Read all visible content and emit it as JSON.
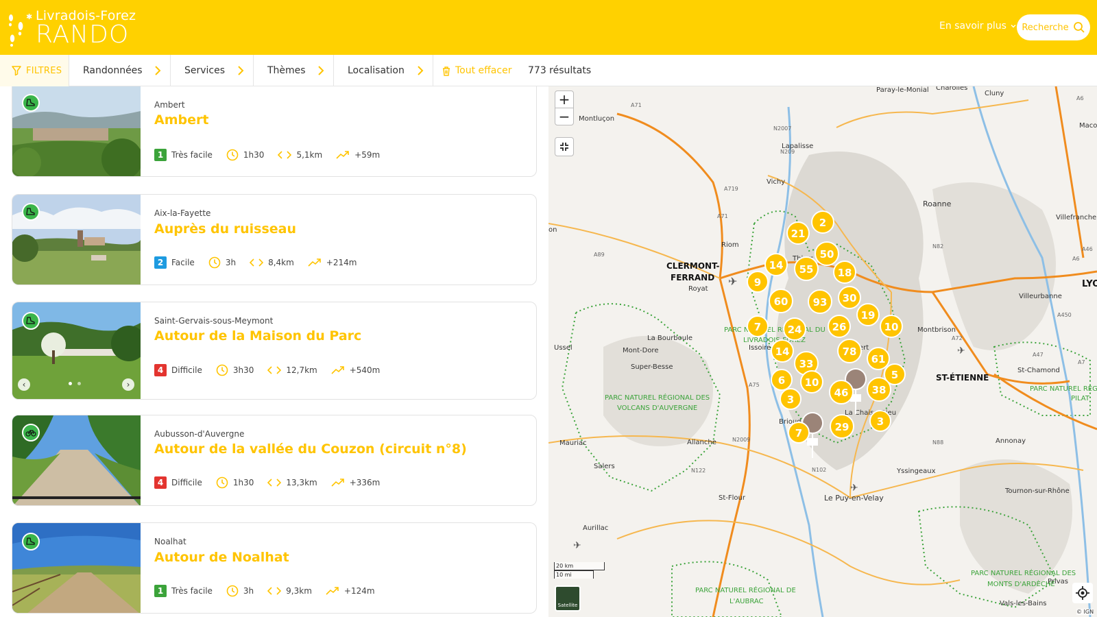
{
  "header": {
    "logo_line1": "Livradois-Forez",
    "logo_line2": "RANDO",
    "learn_more": "En savoir plus",
    "search_label": "Recherche"
  },
  "filters": {
    "filters_label": "FILTRES",
    "hikes_label": "Randonnées",
    "services_label": "Services",
    "themes_label": "Thèmes",
    "location_label": "Localisation",
    "clear_label": "Tout effacer",
    "results_count": "773 résultats"
  },
  "colors": {
    "brand_yellow": "#FFD100",
    "title_yellow": "#FFC400",
    "difficulty_easy": "#3BA33A",
    "difficulty_facile": "#1E9BE0",
    "difficulty_hard": "#E3342F",
    "activity_badge": "#3BB54A"
  },
  "results": [
    {
      "city": "Ambert",
      "title": "Ambert",
      "difficulty_level": "1",
      "difficulty_label": "Très facile",
      "duration": "1h30",
      "distance": "5,1km",
      "elevation": "+59m",
      "activity_icon": "hiking-boot-icon"
    },
    {
      "city": "Aix-la-Fayette",
      "title": "Auprès du ruisseau",
      "difficulty_level": "2",
      "difficulty_label": "Facile",
      "duration": "3h",
      "distance": "8,4km",
      "elevation": "+214m",
      "activity_icon": "hiking-boot-icon"
    },
    {
      "city": "Saint-Gervais-sous-Meymont",
      "title": "Autour de la Maison du Parc",
      "difficulty_level": "4",
      "difficulty_label": "Difficile",
      "duration": "3h30",
      "distance": "12,7km",
      "elevation": "+540m",
      "activity_icon": "hiking-boot-icon"
    },
    {
      "city": "Aubusson-d'Auvergne",
      "title": "Autour de la vallée du Couzon (circuit n°8)",
      "difficulty_level": "4",
      "difficulty_label": "Difficile",
      "duration": "1h30",
      "distance": "13,3km",
      "elevation": "+336m",
      "activity_icon": "bicycle-icon"
    },
    {
      "city": "Noalhat",
      "title": "Autour de Noalhat",
      "difficulty_level": "1",
      "difficulty_label": "Très facile",
      "duration": "3h",
      "distance": "9,3km",
      "elevation": "+124m",
      "activity_icon": "hiking-boot-icon"
    }
  ],
  "map": {
    "zoom_in": "+",
    "zoom_out": "−",
    "satellite_label": "Satellite",
    "scale_km": "20 km",
    "scale_mi": "10 mi",
    "attribution": "© IGN",
    "clusters": [
      "2",
      "21",
      "50",
      "14",
      "55",
      "18",
      "9",
      "60",
      "93",
      "30",
      "7",
      "24",
      "26",
      "19",
      "10",
      "14",
      "78",
      "61",
      "33",
      "6",
      "10",
      "5",
      "3",
      "46",
      "38",
      "7",
      "29",
      "3"
    ],
    "places": [
      "Paray-le-Monial",
      "Charolles",
      "Cluny",
      "Montluçon",
      "Lapalisse",
      "Vichy",
      "Roanne",
      "Villefranche",
      "Riom",
      "Thiers",
      "CLERMONT-",
      "FERRAND",
      "Royat",
      "Villeurbanne",
      "LYO",
      "Montbrison",
      "Ussel",
      "La Bourboule",
      "Mont-Dore",
      "Super-Besse",
      "Issoire",
      "Ambert",
      "ST-ÉTIENNE",
      "St-Chamond",
      "PARC NATUREL RÉGIONAL DES",
      "VOLCANS D'AUVERGNE",
      "PARC NATUREL RÉGIONAL DU",
      "LIVRADOIS-FOREZ",
      "PARC NATUREL RÉG",
      "PILAT",
      "Brioude",
      "La Chaise-Dieu",
      "Annonay",
      "Mauriac",
      "Allanche",
      "Salers",
      "Yssingeaux",
      "Tournon-sur-Rhône",
      "St-Flour",
      "Le Puy-en-Velay",
      "Aurillac",
      "PARC NATUREL RÉGIONAL DES",
      "MONTS D'ARDÈCHE",
      "Privas",
      "PARC NATUREL RÉGIONAL DE",
      "L'AUBRAC",
      "Vals-les-Bains",
      "Macon",
      "on"
    ],
    "roads": [
      "A71",
      "N2007",
      "N209",
      "A719",
      "A71",
      "A6",
      "N82",
      "A46",
      "A6",
      "A72",
      "A47",
      "A7",
      "A89",
      "A75",
      "N102",
      "N88",
      "N2009",
      "N122",
      "A450"
    ]
  }
}
